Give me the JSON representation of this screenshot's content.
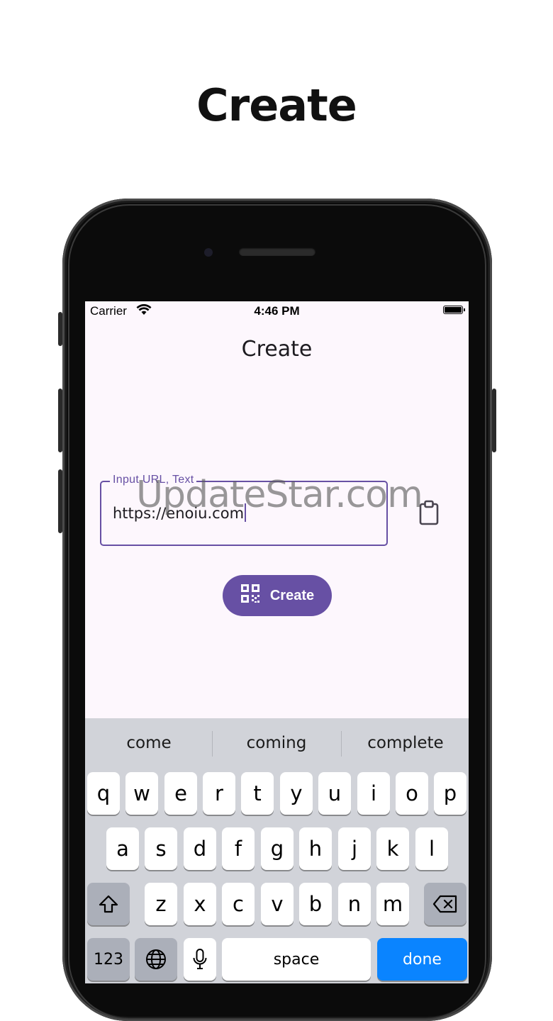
{
  "banner": {
    "title": "Create"
  },
  "watermark": {
    "text": "UpdateStar.com"
  },
  "status_bar": {
    "carrier": "Carrier",
    "time": "4:46 PM"
  },
  "app": {
    "title": "Create",
    "input": {
      "label": "Input URL, Text",
      "value": "https://enoiu.com"
    },
    "paste_icon": "clipboard-icon",
    "create_button": {
      "label": "Create",
      "icon": "qr-code-icon"
    },
    "accent_color": "#6750a4"
  },
  "keyboard": {
    "suggestions": [
      "come",
      "coming",
      "complete"
    ],
    "row1": [
      "q",
      "w",
      "e",
      "r",
      "t",
      "y",
      "u",
      "i",
      "o",
      "p"
    ],
    "row2": [
      "a",
      "s",
      "d",
      "f",
      "g",
      "h",
      "j",
      "k",
      "l"
    ],
    "row3": [
      "z",
      "x",
      "c",
      "v",
      "b",
      "n",
      "m"
    ],
    "numbers_label": "123",
    "space_label": "space",
    "done_label": "done",
    "icons": {
      "shift": "shift-icon",
      "delete": "backspace-icon",
      "globe": "globe-icon",
      "mic": "microphone-icon"
    },
    "done_color": "#0a84ff"
  }
}
